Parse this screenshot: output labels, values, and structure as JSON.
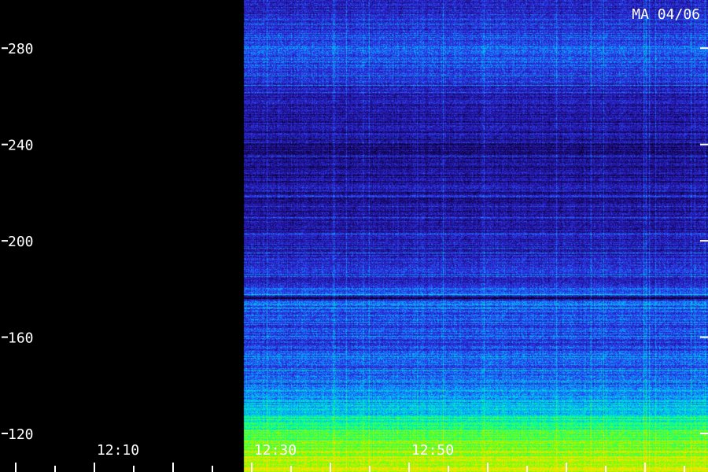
{
  "chart_data": {
    "type": "heatmap",
    "title": "",
    "stamp": "MA 04/06",
    "xlabel": "",
    "ylabel": "",
    "ylim": [
      104,
      300
    ],
    "yticks": [
      120,
      160,
      200,
      240,
      280
    ],
    "ytick_labels": [
      "120",
      "160",
      "200",
      "240",
      "280"
    ],
    "xlim_minutes": [
      0,
      90
    ],
    "xtick_labels": [
      {
        "minute": 20,
        "label": "12:10"
      },
      {
        "minute": 40,
        "label": "12:30"
      },
      {
        "minute": 60,
        "label": "12:50"
      }
    ],
    "data_start_minute": 31,
    "colormap": [
      "#000000",
      "#1a0a7a",
      "#3030e8",
      "#00b4ff",
      "#00ffa0",
      "#7cff00",
      "#ffe000"
    ],
    "intensity_profile": [
      {
        "y": 104,
        "level": 0.93
      },
      {
        "y": 112,
        "level": 0.86
      },
      {
        "y": 120,
        "level": 0.74
      },
      {
        "y": 128,
        "level": 0.58
      },
      {
        "y": 136,
        "level": 0.45
      },
      {
        "y": 150,
        "level": 0.36
      },
      {
        "y": 165,
        "level": 0.34
      },
      {
        "y": 175,
        "level": 0.4
      },
      {
        "y": 176.5,
        "level": 0.1
      },
      {
        "y": 178,
        "level": 0.46
      },
      {
        "y": 182,
        "level": 0.3
      },
      {
        "y": 200,
        "level": 0.24
      },
      {
        "y": 220,
        "level": 0.2
      },
      {
        "y": 240,
        "level": 0.19
      },
      {
        "y": 262,
        "level": 0.25
      },
      {
        "y": 272,
        "level": 0.36
      },
      {
        "y": 282,
        "level": 0.38
      },
      {
        "y": 292,
        "level": 0.28
      },
      {
        "y": 300,
        "level": 0.26
      }
    ]
  }
}
